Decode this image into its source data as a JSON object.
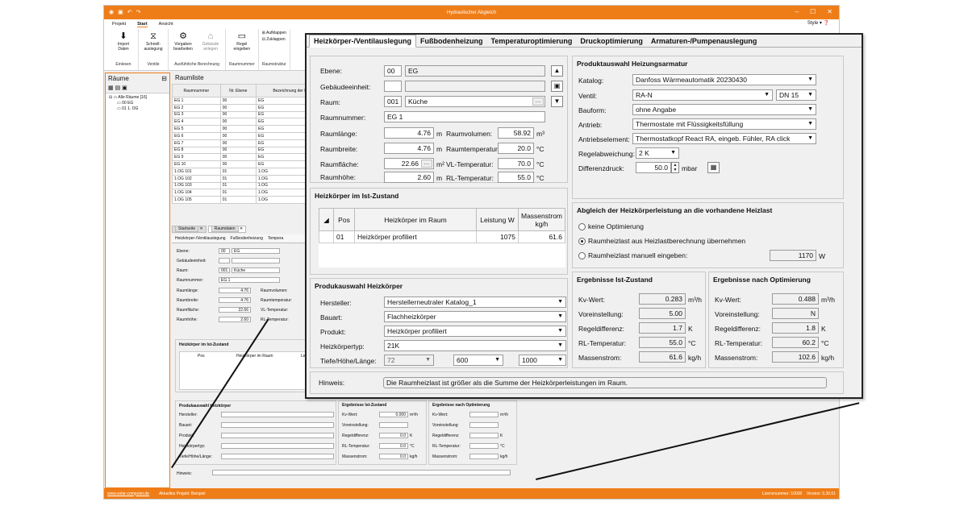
{
  "window": {
    "title": "Hydraulischer Abgleich",
    "style_label": "Style"
  },
  "menu": [
    "Projekt",
    "Start",
    "Ansicht"
  ],
  "ribbon": {
    "groups": [
      {
        "label": "Einlesen",
        "buttons": [
          "Import Daten"
        ]
      },
      {
        "label": "Ventile",
        "buttons": [
          "Schnell-auslegung"
        ]
      },
      {
        "label": "Ausführliche Berechnung",
        "buttons": [
          "Vorgaben bearbeiten",
          "Gebäude anlegen"
        ]
      },
      {
        "label": "Raumnummer",
        "buttons": [
          "Regel eingeben"
        ]
      },
      {
        "label": "Raumstruktur",
        "buttons": [
          "Aufklappen",
          "Zuklappen"
        ]
      }
    ]
  },
  "left_pane": {
    "title": "Räume",
    "tree": [
      "Alle Räume [16]",
      "00 EG",
      "01 1. OG"
    ]
  },
  "room_list": {
    "title": "Raumliste",
    "columns": [
      "Raumnummer",
      "Nr. Ebene",
      "Bezeichnung der Ebene"
    ],
    "rows": [
      [
        "EG 1",
        "00",
        "EG"
      ],
      [
        "EG 2",
        "00",
        "EG"
      ],
      [
        "EG 3",
        "00",
        "EG"
      ],
      [
        "EG 4",
        "00",
        "EG"
      ],
      [
        "EG 5",
        "00",
        "EG"
      ],
      [
        "EG 6",
        "00",
        "EG"
      ],
      [
        "EG 7",
        "00",
        "EG"
      ],
      [
        "EG 8",
        "00",
        "EG"
      ],
      [
        "EG 9",
        "00",
        "EG"
      ],
      [
        "EG 10",
        "00",
        "EG"
      ],
      [
        "1.OG 101",
        "01",
        "1.OG"
      ],
      [
        "1.OG 102",
        "01",
        "1.OG"
      ],
      [
        "1.OG 103",
        "01",
        "1.OG"
      ],
      [
        "1.OG 104",
        "01",
        "1.OG"
      ],
      [
        "1.OG 105",
        "01",
        "1.OG"
      ]
    ]
  },
  "doc_tabs": [
    "Startseite",
    "Raumdaten"
  ],
  "bg_form": {
    "tabs": [
      "Heizkörper-/Ventilauslegung",
      "Fußbodenheizung",
      "Tempera"
    ],
    "labels": [
      "Ebene:",
      "Gebäudeeinheit:",
      "Raum:",
      "Raumnummer:",
      "Raumlänge:",
      "Raumbreite:",
      "Raumfläche:",
      "Raumhöhe:"
    ],
    "values": [
      "00",
      "EG",
      "001",
      "Küche",
      "EG 1",
      "4.76",
      "4.76",
      "22.66",
      "2.60"
    ],
    "right_labels": [
      "Raumvolumen:",
      "Raumtemperatur:",
      "VL-Temperatur:",
      "RL-Temperatur:"
    ],
    "ist_title": "Heizkörper im Ist-Zustand",
    "ist_cols": [
      "Pos",
      "Heizkörper im Raum",
      "Leistu"
    ],
    "produkt_title": "Produkauswahl Heizkörper",
    "produkt_labels": [
      "Hersteller:",
      "Bauart:",
      "Produkt:",
      "Heizkörpertyp:",
      "Tiefe/Höhe/Länge:"
    ],
    "ist_res_title": "Ergebnisse Ist-Zustand",
    "opt_res_title": "Ergebnisse nach Optimierung",
    "res_labels": [
      "Kv-Wert:",
      "Voreinstellung:",
      "Regeldifferenz:",
      "RL-Temperatur:",
      "Massenstrom:"
    ],
    "ist_values": [
      "0.000",
      "",
      "0.0",
      "0.0",
      "0.0"
    ],
    "units": [
      "m³/h",
      "",
      "K",
      "°C",
      "kg/h"
    ],
    "hinweis": "Hinweis:"
  },
  "status": {
    "url": "www.solar-computer.de",
    "project": "Aktuelles Projekt: Beispiel",
    "license": "Lizenznummer: 10000",
    "version": "Version: 5.30.01"
  },
  "zoom": {
    "tabs": [
      "Heizkörper-/Ventilauslegung",
      "Fußbodenheizung",
      "Temperaturoptimierung",
      "Druckoptimierung",
      "Armaturen-/Pumpenauslegung"
    ],
    "room": {
      "ebene_label": "Ebene:",
      "ebene_nr": "00",
      "ebene_name": "EG",
      "einheit_label": "Gebäudeeinheit:",
      "raum_label": "Raum:",
      "raum_nr": "001",
      "raum_name": "Küche",
      "raumnummer_label": "Raumnummer:",
      "raumnummer": "EG 1",
      "laenge_label": "Raumlänge:",
      "laenge": "4.76",
      "breite_label": "Raumbreite:",
      "breite": "4.76",
      "flaeche_label": "Raumfläche:",
      "flaeche": "22.66",
      "hoehe_label": "Raumhöhe:",
      "hoehe": "2.60",
      "volumen_label": "Raumvolumen:",
      "volumen": "58.92",
      "temp_label": "Raumtemperatur:",
      "temp": "20.0",
      "vl_label": "VL-Temperatur:",
      "vl": "70.0",
      "rl_label": "RL-Temperatur:",
      "rl": "55.0",
      "u_m": "m",
      "u_m2": "m²",
      "u_m3": "m³",
      "u_c": "°C"
    },
    "ist": {
      "title": "Heizkörper im Ist-Zustand",
      "cols": [
        "Pos",
        "Heizkörper im Raum",
        "Leistung W",
        "Massenstrom kg/h"
      ],
      "row": [
        "01",
        "Heizkörper profiliert",
        "1075",
        "61.6"
      ]
    },
    "produkt": {
      "title": "Produkauswahl Heizkörper",
      "hersteller_label": "Hersteller:",
      "hersteller": "Herstellerneutraler Katalog_1",
      "bauart_label": "Bauart:",
      "bauart": "Flachheizkörper",
      "produkt_label": "Produkt:",
      "produkt": "Heizkörper profiliert",
      "typ_label": "Heizkörpertyp:",
      "typ": "21K",
      "thl_label": "Tiefe/Höhe/Länge:",
      "tiefe": "72",
      "hoehe": "600",
      "laenge": "1000"
    },
    "armatur": {
      "title": "Produktauswahl Heizungsarmatur",
      "katalog_label": "Katalog:",
      "katalog": "Danfoss Wärmeautomatik 20230430",
      "ventil_label": "Ventil:",
      "ventil": "RA-N",
      "dn": "DN 15",
      "bauform_label": "Bauform:",
      "bauform": "ohne Angabe",
      "antrieb_label": "Antrieb:",
      "antrieb": "Thermostate mit Flüssigkeitsfüllung",
      "element_label": "Antriebselement:",
      "element": "Thermostatkopf React RA, eingeb. Fühler, RA click",
      "regelab_label": "Regelabweichung:",
      "regelab": "2 K",
      "diffdruck_label": "Differenzdruck:",
      "diffdruck": "50.0",
      "diffdruck_unit": "mbar"
    },
    "abgleich": {
      "title": "Abgleich der Heizkörperleistung an die vorhandene Heizlast",
      "opt1": "keine Optimierung",
      "opt2": "Raumheizlast aus Heizlastberechnung übernehmen",
      "opt3": "Raumheizlast manuell eingeben:",
      "value": "1170",
      "unit": "W"
    },
    "ist_res": {
      "title": "Ergebnisse Ist-Zustand",
      "labels": [
        "Kv-Wert:",
        "Voreinstellung:",
        "Regeldifferenz:",
        "RL-Temperatur:",
        "Massenstrom:"
      ],
      "values": [
        "0.283",
        "5.00",
        "1.7",
        "55.0",
        "61.6"
      ],
      "units": [
        "m³/h",
        "",
        "K",
        "°C",
        "kg/h"
      ]
    },
    "opt_res": {
      "title": "Ergebnisse nach Optimierung",
      "labels": [
        "Kv-Wert:",
        "Voreinstellung:",
        "Regeldifferenz:",
        "RL-Temperatur:",
        "Massenstrom:"
      ],
      "values": [
        "0.488",
        "N",
        "1.8",
        "60.2",
        "102.6"
      ],
      "units": [
        "m³/h",
        "",
        "K",
        "°C",
        "kg/h"
      ]
    },
    "hinweis": {
      "label": "Hinweis:",
      "text": "Die Raumheizlast ist größer als die Summe der Heizkörperleistungen im Raum."
    }
  },
  "colors": {
    "accent": "#ef7d17"
  }
}
